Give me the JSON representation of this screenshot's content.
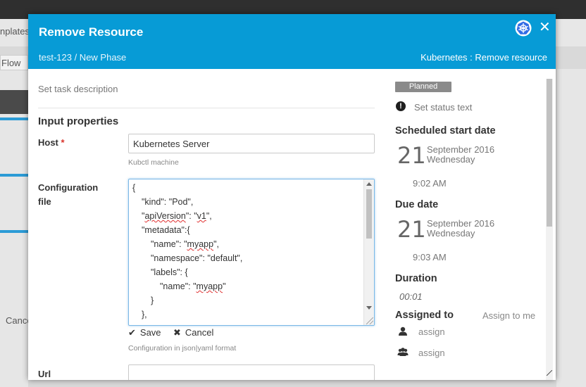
{
  "background": {
    "tab_label": "nplates",
    "flow_label": "Flow",
    "cancel_label": "Cance"
  },
  "modal": {
    "title": "Remove Resource",
    "breadcrumb": "test-123 / New Phase",
    "task_type": "Kubernetes : Remove resource",
    "icons": {
      "plugin": "kubernetes-icon",
      "close": "close-icon"
    }
  },
  "form": {
    "description_placeholder": "Set task description",
    "section_title": "Input properties",
    "host": {
      "label": "Host",
      "required_mark": "*",
      "value": "Kubernetes Server",
      "help": "Kubctl machine"
    },
    "config": {
      "label_line1": "Configuration",
      "label_line2": "file",
      "lines": [
        "{",
        "\"kind\": \"Pod\",",
        "\"apiVersion\": \"v1\",",
        "\"metadata\":{",
        "\"name\": \"myapp\",",
        "\"namespace\": \"default\",",
        "\"labels\": {",
        "\"name\": \"myapp\"",
        "}",
        "},"
      ],
      "save_label": "Save",
      "cancel_label": "Cancel",
      "help": "Configuration in json|yaml format"
    },
    "url": {
      "label": "Url",
      "value": ""
    }
  },
  "sidebar": {
    "status_badge": "Planned",
    "status_text": "Set status text",
    "scheduled": {
      "title": "Scheduled start date",
      "day": "21",
      "month_year": "September 2016",
      "weekday": "Wednesday",
      "time": "9:02 AM"
    },
    "due": {
      "title": "Due date",
      "day": "21",
      "month_year": "September 2016",
      "weekday": "Wednesday",
      "time": "9:03 AM"
    },
    "duration": {
      "title": "Duration",
      "value": "00:01"
    },
    "assigned": {
      "title": "Assigned to",
      "assign_me": "Assign to me",
      "user_assign": "assign",
      "team_assign": "assign"
    },
    "colors": {
      "header": "#079bd6",
      "badge": "#8a8a8a",
      "required": "#d9342b"
    }
  }
}
